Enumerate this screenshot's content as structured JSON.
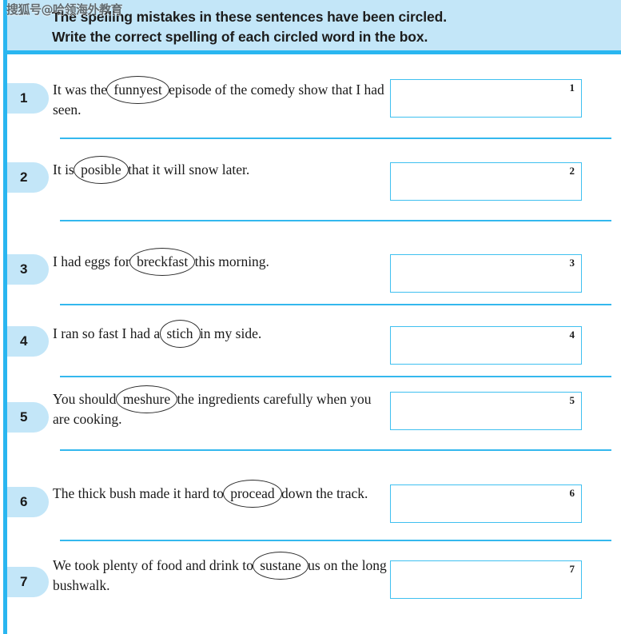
{
  "watermark": {
    "text": "搜狐号@哈领海外教育"
  },
  "header": {
    "line1": "The spelling mistakes in these sentences have been circled.",
    "line2": "Write the correct spelling of each circled word in the box."
  },
  "colors": {
    "accent_cyan": "#29b6f0",
    "pill_blue": "#c3e6f8",
    "box_border": "#3fc0f0",
    "text": "#1a1a1a"
  },
  "questions": [
    {
      "number": "1",
      "before": "It was the ",
      "circled": "funnyest",
      "after": " episode of the comedy show that I had seen.",
      "mark": "1"
    },
    {
      "number": "2",
      "before": "It is ",
      "circled": "posible",
      "after": " that it will snow later.",
      "mark": "2"
    },
    {
      "number": "3",
      "before": "I had eggs for ",
      "circled": "breckfast",
      "after": " this morning.",
      "mark": "3"
    },
    {
      "number": "4",
      "before": "I ran so fast I had a ",
      "circled": "stich",
      "after": " in my side.",
      "mark": "4"
    },
    {
      "number": "5",
      "before": "You should ",
      "circled": "meshure",
      "after": " the ingredients carefully when you are cooking.",
      "mark": "5"
    },
    {
      "number": "6",
      "before": "The thick bush made it hard to ",
      "circled": "procead",
      "after": " down the track.",
      "mark": "6"
    },
    {
      "number": "7",
      "before": "We took plenty of food and drink to ",
      "circled": "sustane",
      "after": " us on the long bushwalk.",
      "mark": "7"
    }
  ]
}
